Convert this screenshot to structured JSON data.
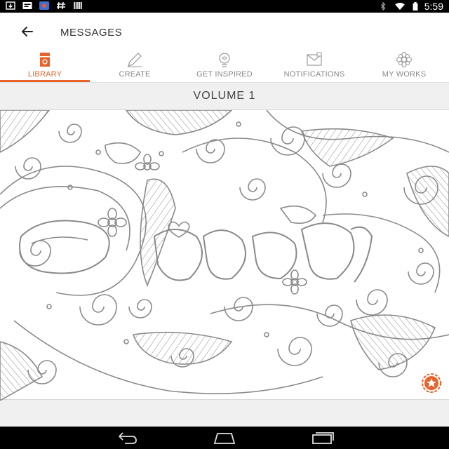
{
  "status_bar": {
    "time": "5:59",
    "left_icons": [
      "download-icon",
      "message-icon",
      "app-icon",
      "hash-icon",
      "barcode-icon"
    ],
    "right_icons": [
      "bluetooth-icon",
      "wifi-icon",
      "battery-icon"
    ]
  },
  "header": {
    "title": "MESSAGES"
  },
  "tabs": [
    {
      "label": "LIBRARY",
      "icon": "library-icon",
      "active": true
    },
    {
      "label": "CREATE",
      "icon": "pencil-icon",
      "active": false
    },
    {
      "label": "GET INSPIRED",
      "icon": "lightbulb-search-icon",
      "active": false
    },
    {
      "label": "NOTIFICATIONS",
      "icon": "envelope-icon",
      "active": false
    },
    {
      "label": "MY WORKS",
      "icon": "flower-icon",
      "active": false
    }
  ],
  "content": {
    "volume_title": "VOLUME 1",
    "artwork": {
      "lettering": "Flowers",
      "favorite_icon": "star-badge-icon"
    }
  },
  "nav_bar": {
    "buttons": [
      "back-nav-icon",
      "home-nav-icon",
      "recents-nav-icon"
    ]
  },
  "colors": {
    "accent": "#e8632b",
    "tab_inactive": "#888888",
    "line_art": "#8a8a8a",
    "content_bg": "#f0f0f0"
  }
}
